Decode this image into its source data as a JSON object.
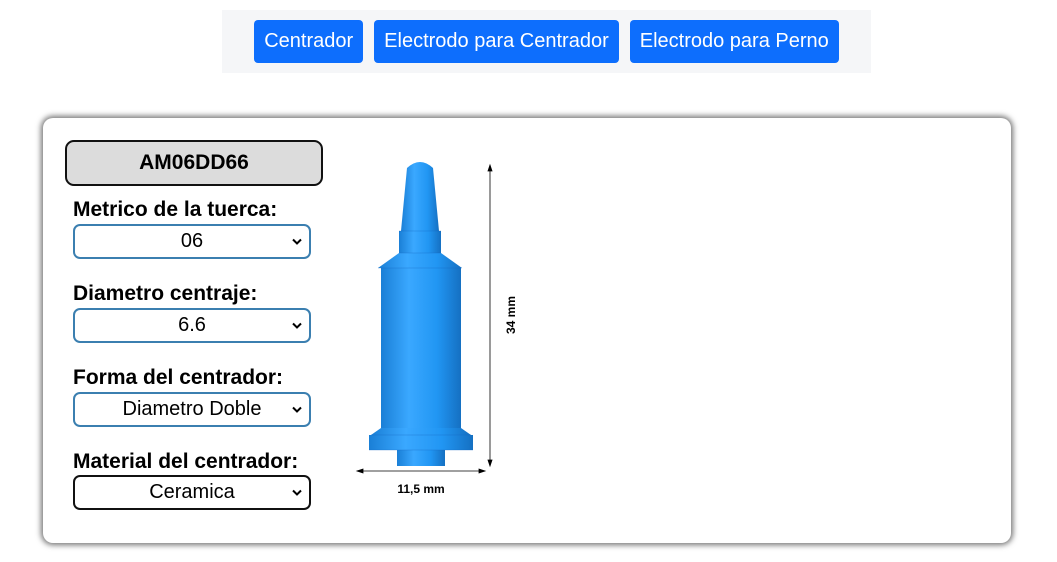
{
  "nav": {
    "buttons": [
      {
        "label": "Centrador"
      },
      {
        "label": "Electrodo para Centrador"
      },
      {
        "label": "Electrodo para Perno"
      }
    ]
  },
  "product": {
    "code": "AM06DD66"
  },
  "form": {
    "fields": [
      {
        "label": "Metrico de la tuerca:",
        "value": "06"
      },
      {
        "label": "Diametro centraje:",
        "value": "6.6"
      },
      {
        "label": "Forma del centrador:",
        "value": "Diametro Doble"
      },
      {
        "label": "Material del centrador:",
        "value": "Ceramica"
      }
    ]
  },
  "drawing": {
    "height_label": "34 mm",
    "width_label": "11,5 mm",
    "part_color": "#2196f3"
  }
}
